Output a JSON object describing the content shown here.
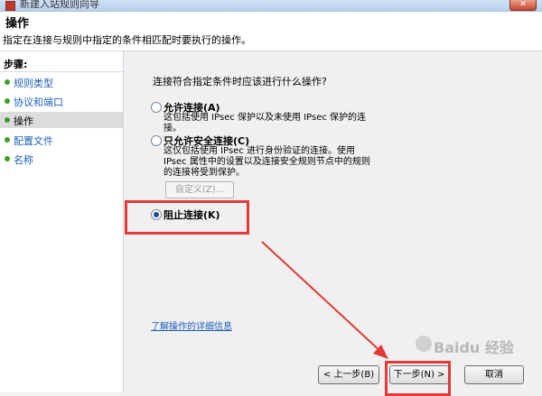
{
  "window": {
    "title": "新建入站规则向导",
    "close_glyph": "✕"
  },
  "header": {
    "title": "操作",
    "description": "指定在连接与规则中指定的条件相匹配时要执行的操作。"
  },
  "sidebar": {
    "label": "步骤:",
    "items": [
      {
        "label": "规则类型"
      },
      {
        "label": "协议和端口"
      },
      {
        "label": "操作"
      },
      {
        "label": "配置文件"
      },
      {
        "label": "名称"
      }
    ]
  },
  "main": {
    "question": "连接符合指定条件时应该进行什么操作?",
    "options": [
      {
        "label": "允许连接(A)",
        "desc": "这包括使用 IPsec 保护以及未使用 IPsec 保护的连接。"
      },
      {
        "label": "只允许安全连接(C)",
        "desc": "这仅包括使用 IPsec 进行身份验证的连接。使用 IPsec 属性中的设置以及连接安全规则节点中的规则的连接将受到保护。"
      },
      {
        "label": "阻止连接(K)",
        "desc": ""
      }
    ],
    "customize_label": "自定义(Z)...",
    "detail_link": "了解操作的详细信息"
  },
  "footer": {
    "back_label": "< 上一步(B)",
    "next_label": "下一步(N) >",
    "cancel_label": "取消"
  },
  "watermark": "Baidu 经验",
  "colors": {
    "highlight": "#e53935",
    "link": "#1d5fb8",
    "step_bullet": "#38a028"
  }
}
